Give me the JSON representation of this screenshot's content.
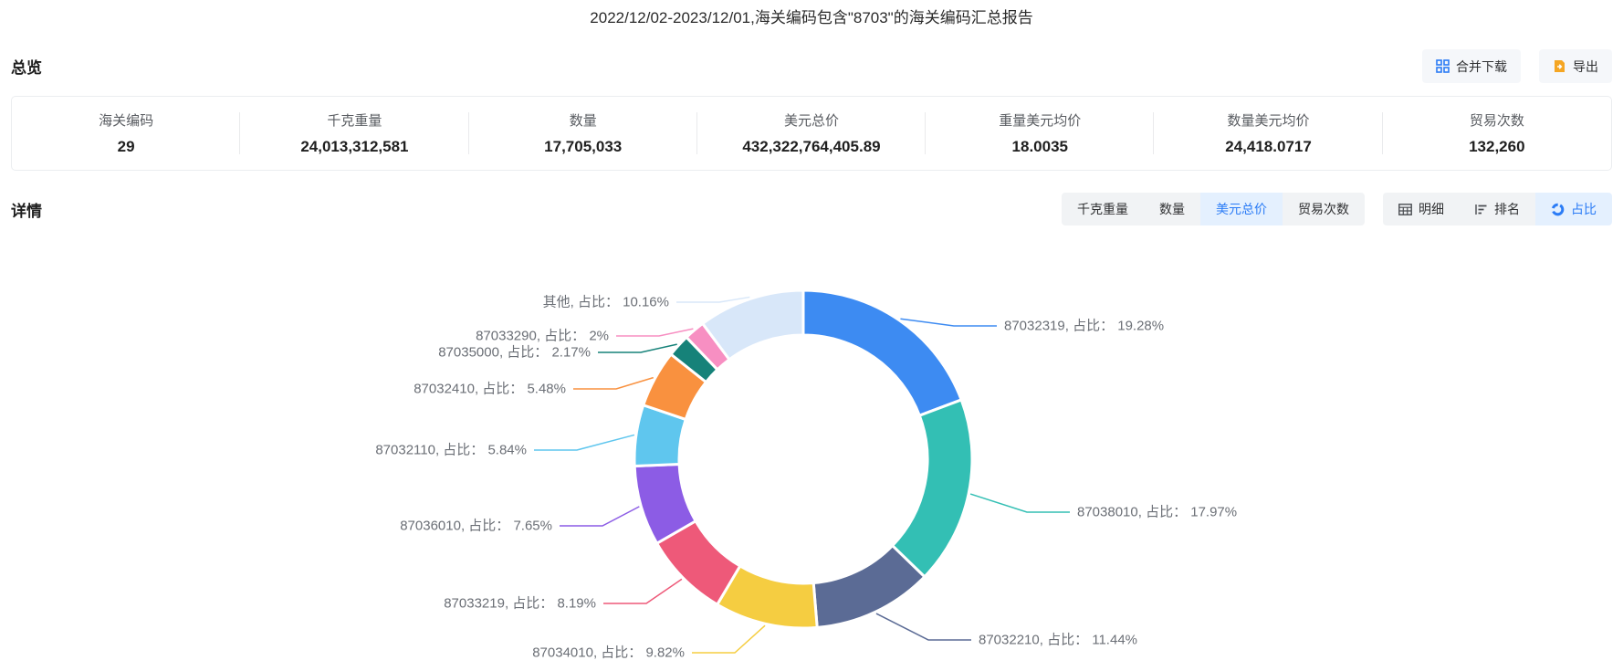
{
  "title": "2022/12/02-2023/12/01,海关编码包含\"8703\"的海关编码汇总报告",
  "overview": {
    "heading": "总览",
    "actions": [
      {
        "label": "合并下载",
        "icon": "merge-download-icon"
      },
      {
        "label": "导出",
        "icon": "export-icon"
      }
    ],
    "stats": [
      {
        "label": "海关编码",
        "value": "29"
      },
      {
        "label": "千克重量",
        "value": "24,013,312,581"
      },
      {
        "label": "数量",
        "value": "17,705,033"
      },
      {
        "label": "美元总价",
        "value": "432,322,764,405.89"
      },
      {
        "label": "重量美元均价",
        "value": "18.0035"
      },
      {
        "label": "数量美元均价",
        "value": "24,418.0717"
      },
      {
        "label": "贸易次数",
        "value": "132,260"
      }
    ]
  },
  "detail": {
    "heading": "详情",
    "metric_tabs": [
      {
        "label": "千克重量",
        "active": false
      },
      {
        "label": "数量",
        "active": false
      },
      {
        "label": "美元总价",
        "active": true
      },
      {
        "label": "贸易次数",
        "active": false
      }
    ],
    "view_tabs": [
      {
        "label": "明细",
        "icon": "table-icon",
        "active": false
      },
      {
        "label": "排名",
        "icon": "rank-icon",
        "active": false
      },
      {
        "label": "占比",
        "icon": "donut-icon",
        "active": true
      }
    ]
  },
  "colors": {
    "accent": "#2b7cf6",
    "active_tab_bg": "#e4f0fe",
    "tab_bg": "#f1f3f5",
    "export_icon": "#f5a623"
  },
  "chart_data": {
    "type": "pie",
    "donut": true,
    "start_angle_deg": 0,
    "clockwise": true,
    "label_word": "占比",
    "legend": "none",
    "series": [
      {
        "name": "87032319",
        "value": 19.28,
        "pct": "19.28%",
        "color": "#3d8bf2"
      },
      {
        "name": "87038010",
        "value": 17.97,
        "pct": "17.97%",
        "color": "#33bfb4"
      },
      {
        "name": "87032210",
        "value": 11.44,
        "pct": "11.44%",
        "color": "#5b6b95"
      },
      {
        "name": "87034010",
        "value": 9.82,
        "pct": "9.82%",
        "color": "#f5cd41"
      },
      {
        "name": "87033219",
        "value": 8.19,
        "pct": "8.19%",
        "color": "#ee5979"
      },
      {
        "name": "87036010",
        "value": 7.65,
        "pct": "7.65%",
        "color": "#8c5ce5"
      },
      {
        "name": "87032110",
        "value": 5.84,
        "pct": "5.84%",
        "color": "#5fc6ee"
      },
      {
        "name": "87032410",
        "value": 5.48,
        "pct": "5.48%",
        "color": "#f9913f"
      },
      {
        "name": "87035000",
        "value": 2.17,
        "pct": "2.17%",
        "color": "#168279"
      },
      {
        "name": "87033290",
        "value": 2.0,
        "pct": "2%",
        "color": "#f78fc2"
      },
      {
        "name": "其他",
        "value": 10.16,
        "pct": "10.16%",
        "color": "#d8e7f9"
      }
    ]
  }
}
